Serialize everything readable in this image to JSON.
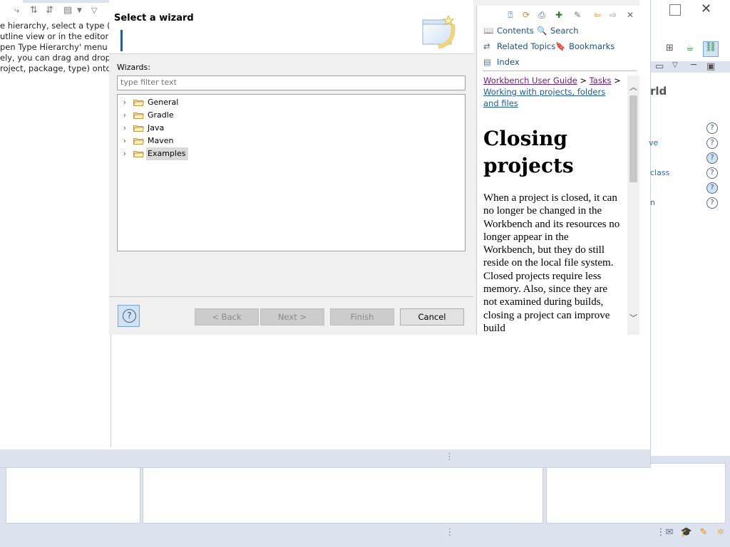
{
  "left_panel": {
    "text": "e hierarchy, select a type (for\nutline view or in the editor),\npen Type Hierarchy' menu\nely, you can drag and drop\nroject, package, type) onto"
  },
  "right_panel": {
    "heading_fragment": "rld",
    "link_fragments": [
      "ve",
      "class",
      "n"
    ]
  },
  "dialog": {
    "title": "Select a wizard",
    "wizards_label": "Wizards:",
    "filter_placeholder": "type filter text",
    "tree": [
      {
        "label": "General"
      },
      {
        "label": "Gradle"
      },
      {
        "label": "Java"
      },
      {
        "label": "Maven"
      },
      {
        "label": "Examples",
        "selected": true
      }
    ],
    "buttons": {
      "help": "?",
      "back": "< Back",
      "next": "Next >",
      "finish": "Finish",
      "cancel": "Cancel"
    }
  },
  "help_panel": {
    "links": {
      "contents": "Contents",
      "search": "Search",
      "related": "Related Topics",
      "bookmarks": "Bookmarks",
      "index": "Index"
    },
    "breadcrumb": {
      "guide": "Workbench User Guide",
      "sep1": " > ",
      "tasks": "Tasks",
      "sep2": " >",
      "current": "Working with projects, folders and files"
    },
    "doc_title": "Closing projects",
    "doc_body": "When a project is closed, it can no longer be changed in the Workbench and its resources no longer appear in the Workbench, but they do still reside on the local file system. Closed projects require less memory. Also, since they are not examined during builds, closing a project can improve build"
  },
  "colors": {
    "accent": "#0a64c8",
    "link": "#1e4f8a",
    "visited_link": "#6b1c7a",
    "status_bar": "#dde3ee"
  },
  "icons": [
    "new-window-icon",
    "minimize-icon",
    "maximize-icon",
    "close-icon",
    "help-icon",
    "folder-icon",
    "chevron-right-icon",
    "back-arrow-icon",
    "forward-arrow-icon",
    "book-icon",
    "search-icon"
  ]
}
